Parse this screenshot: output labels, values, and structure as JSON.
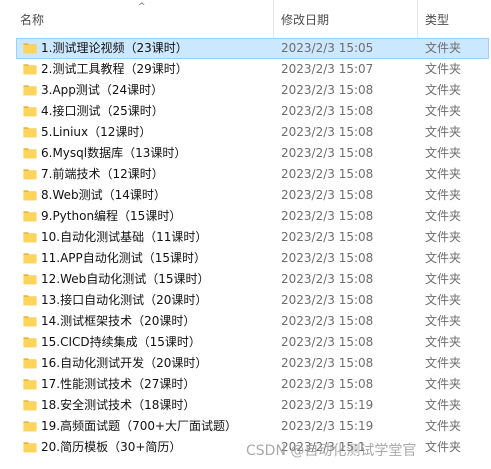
{
  "header": {
    "name": "名称",
    "date": "修改日期",
    "type": "类型",
    "sort_arrow": "^"
  },
  "rows": [
    {
      "name": "1.测试理论视频（23课时）",
      "date": "2023/2/3 15:05",
      "type": "文件夹",
      "selected": true
    },
    {
      "name": "2.测试工具教程（29课时）",
      "date": "2023/2/3 15:07",
      "type": "文件夹"
    },
    {
      "name": "3.App测试（24课时）",
      "date": "2023/2/3 15:08",
      "type": "文件夹"
    },
    {
      "name": "4.接口测试（25课时）",
      "date": "2023/2/3 15:08",
      "type": "文件夹"
    },
    {
      "name": "5.Liniux（12课时）",
      "date": "2023/2/3 15:08",
      "type": "文件夹"
    },
    {
      "name": "6.Mysql数据库（13课时）",
      "date": "2023/2/3 15:08",
      "type": "文件夹"
    },
    {
      "name": "7.前端技术（12课时）",
      "date": "2023/2/3 15:08",
      "type": "文件夹"
    },
    {
      "name": "8.Web测试（14课时）",
      "date": "2023/2/3 15:08",
      "type": "文件夹"
    },
    {
      "name": "9.Python编程（15课时）",
      "date": "2023/2/3 15:08",
      "type": "文件夹"
    },
    {
      "name": "10.自动化测试基础（11课时）",
      "date": "2023/2/3 15:08",
      "type": "文件夹"
    },
    {
      "name": "11.APP自动化测试（15课时）",
      "date": "2023/2/3 15:08",
      "type": "文件夹"
    },
    {
      "name": "12.Web自动化测试（15课时）",
      "date": "2023/2/3 15:08",
      "type": "文件夹"
    },
    {
      "name": "13.接口自动化测试（20课时）",
      "date": "2023/2/3 15:08",
      "type": "文件夹"
    },
    {
      "name": "14.测试框架技术（20课时）",
      "date": "2023/2/3 15:08",
      "type": "文件夹"
    },
    {
      "name": "15.CICD持续集成（15课时）",
      "date": "2023/2/3 15:08",
      "type": "文件夹"
    },
    {
      "name": "16.自动化测试开发（20课时）",
      "date": "2023/2/3 15:08",
      "type": "文件夹"
    },
    {
      "name": "17.性能测试技术（27课时）",
      "date": "2023/2/3 15:08",
      "type": "文件夹"
    },
    {
      "name": "18.安全测试技术（18课时）",
      "date": "2023/2/3 15:19",
      "type": "文件夹"
    },
    {
      "name": "19.高频面试题（700+大厂面试题）",
      "date": "2023/2/3 15:19",
      "type": "文件夹"
    },
    {
      "name": "20.简历模板（30+简历）",
      "date": "2023/2/3 15:1",
      "type": "文件夹"
    }
  ],
  "watermark": "CSDN @自动化测试学堂官",
  "colors": {
    "folder": "#ffd45b",
    "folder_dark": "#e9b53a",
    "selection_bg": "#cce8ff",
    "selection_border": "#99d1ff"
  }
}
